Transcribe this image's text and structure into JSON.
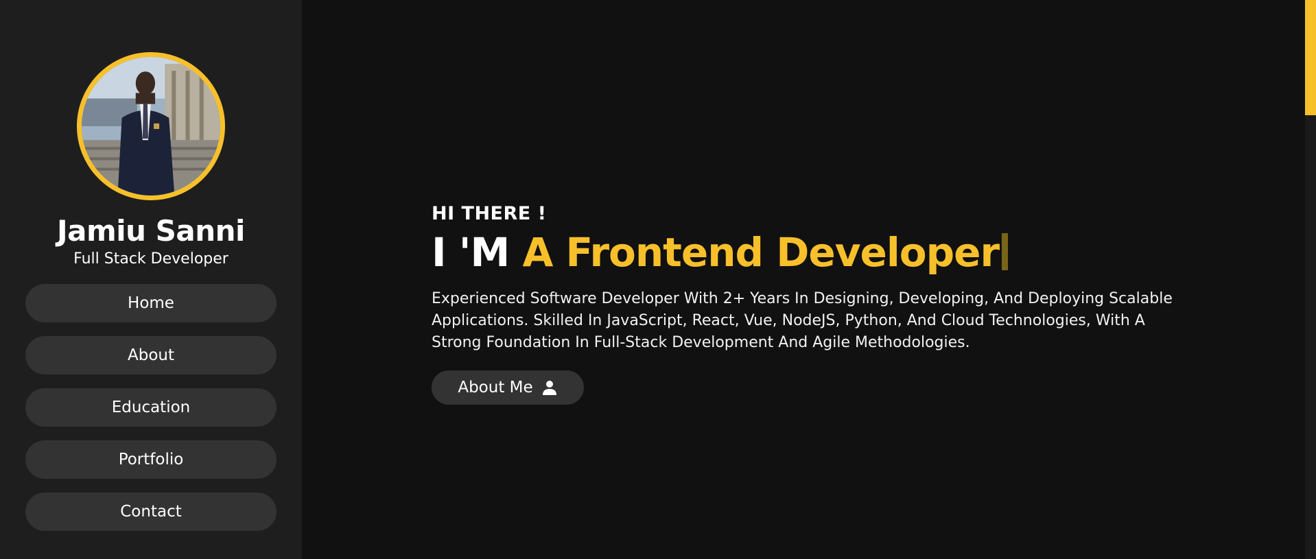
{
  "profile": {
    "name": "Jamiu Sanni",
    "role": "Full Stack Developer"
  },
  "nav": {
    "items": [
      {
        "label": "Home"
      },
      {
        "label": "About"
      },
      {
        "label": "Education"
      },
      {
        "label": "Portfolio"
      },
      {
        "label": "Contact"
      }
    ]
  },
  "hero": {
    "greeting": "HI THERE !",
    "headline_prefix": "I 'M",
    "headline_role": "A Frontend Developer",
    "summary": "Experienced Software Developer With 2+ Years In Designing, Developing, And Deploying Scalable Applications. Skilled In JavaScript, React, Vue, NodeJS, Python, And Cloud Technologies, With A Strong Foundation In Full-Stack Development And Agile Methodologies.",
    "cta_label": "About Me",
    "cta_icon": "user-icon"
  },
  "theme": {
    "accent": "#f7c02b",
    "sidebar_bg": "#1e1e1e",
    "main_bg": "#111111",
    "button_bg": "#333333"
  }
}
